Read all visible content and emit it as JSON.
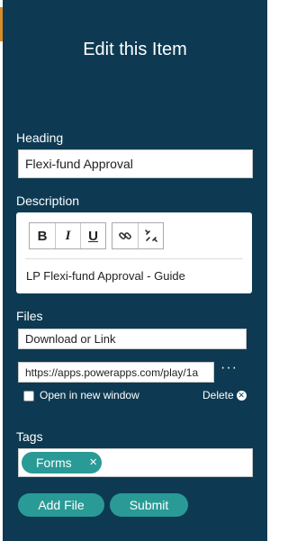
{
  "title": "Edit this Item",
  "heading": {
    "label": "Heading",
    "value": "Flexi-fund Approval"
  },
  "description": {
    "label": "Description",
    "toolbar": {
      "bold": "B",
      "italic": "I",
      "underline": "U"
    },
    "content": "LP Flexi-fund Approval - Guide"
  },
  "files": {
    "label": "Files",
    "name_value": "Download or Link",
    "url_value": "https://apps.powerapps.com/play/1a",
    "more": "···",
    "open_new_window": "Open in new window",
    "delete": "Delete"
  },
  "tags": {
    "label": "Tags",
    "items": [
      {
        "label": "Forms"
      }
    ]
  },
  "actions": {
    "add_file": "Add File",
    "submit": "Submit"
  },
  "colors": {
    "panel": "#0d3a52",
    "accent": "#2a9a96"
  }
}
